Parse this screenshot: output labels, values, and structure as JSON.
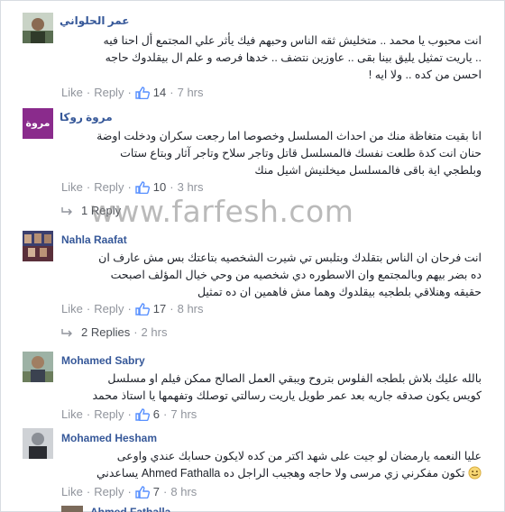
{
  "comments": [
    {
      "name": "عمر الحلواني",
      "lines": [
        "انت محبوب يا محمد .. متخليش ثقه الناس وحبهم فيك يأثر علي المجتمع أل احنا فيه",
        ".. ياريت تمثيل يليق بينا بقى .. عاوزين نتضف .. خدها فرصه و علم ال بيقلدوك حاجه",
        "احسن من كده .. ولا ايه !"
      ],
      "like": "Like",
      "reply": "Reply",
      "likes": "14",
      "time": "7 hrs"
    },
    {
      "name": "مروة روكا",
      "avatar_text": "مروة",
      "lines": [
        "انا بقيت متغاظة منك من احداث المسلسل وخصوصا اما رجعت سكران ودخلت اوضة",
        "حنان انت كدة طلعت نفسك فالمسلسل قاتل وتاجر سلاح وتاجر آثار وبتاع ستات",
        "وبلطجي اية باقى فالمسلسل ميخلنيش اشيل منك"
      ],
      "like": "Like",
      "reply": "Reply",
      "likes": "10",
      "time": "3 hrs",
      "replies_label": "1 Reply"
    },
    {
      "name": "Nahla Raafat",
      "lines": [
        "انت فرحان ان الناس بتقلدك وبتلبس تي شيرت الشخصيه بتاعتك بس مش عارف ان",
        "ده بضر بيهم وبالمجتمع وان الاسطوره دي شخصيه من وحي خيال المؤلف اصبحت",
        "حقيقه وهنلاقي بلطجيه بيقلدوك وهما مش فاهمين ان ده تمثيل"
      ],
      "like": "Like",
      "reply": "Reply",
      "likes": "17",
      "time": "8 hrs",
      "replies_label": "2 Replies",
      "replies_time": "2 hrs"
    },
    {
      "name": "Mohamed Sabry",
      "lines": [
        "بالله عليك بلاش بلطجه الفلوس بتروح ويبقي العمل الصالح ممكن فيلم او مسلسل",
        "كويس يكون صدقه جاريه بعد عمر طويل ياريت رسالتي توصلك وتفهمها يا استاذ محمد"
      ],
      "like": "Like",
      "reply": "Reply",
      "likes": "6",
      "time": "7 hrs"
    },
    {
      "name": "Mohamed Hesham",
      "lines": [
        "عليا النعمه يارمضان لو جيت على شهد اكتر من كده لايكون حسابك عندي واوعى",
        "تكون مفكرني زي مرسى ولا حاجه وهجيب الراجل ده Ahmed Fathalla يساعدني"
      ],
      "like": "Like",
      "reply": "Reply",
      "likes": "7",
      "time": "8 hrs"
    },
    {
      "name": "Ahmed Fathalla"
    }
  ],
  "watermark": "www.farfesh.com",
  "colors": {
    "name": "#365899",
    "meta": "#90949c",
    "text": "#1d2129",
    "like_icon": "#5890ff"
  }
}
